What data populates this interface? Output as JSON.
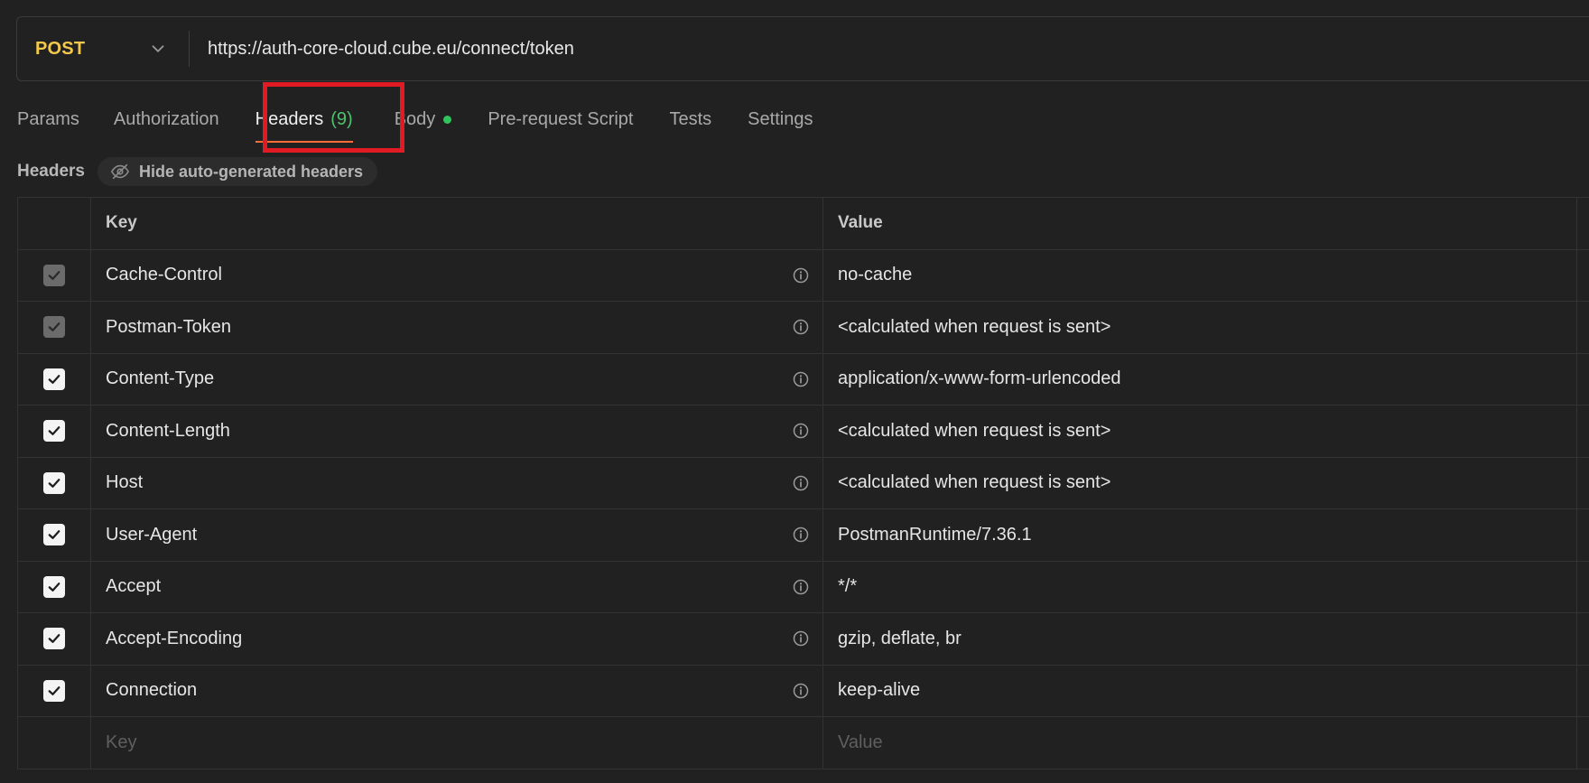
{
  "request": {
    "method": "POST",
    "url": "https://auth-core-cloud.cube.eu/connect/token"
  },
  "tabs": [
    {
      "label": "Params"
    },
    {
      "label": "Authorization"
    },
    {
      "label": "Headers",
      "count": "(9)"
    },
    {
      "label": "Body"
    },
    {
      "label": "Pre-request Script"
    },
    {
      "label": "Tests"
    },
    {
      "label": "Settings"
    }
  ],
  "headers_section": {
    "title": "Headers",
    "hide_button": "Hide auto-generated headers"
  },
  "table": {
    "columns": {
      "key": "Key",
      "value": "Value"
    },
    "rows": [
      {
        "key": "Cache-Control",
        "value": "no-cache",
        "checked": true,
        "disabled": true
      },
      {
        "key": "Postman-Token",
        "value": "<calculated when request is sent>",
        "checked": true,
        "disabled": true
      },
      {
        "key": "Content-Type",
        "value": "application/x-www-form-urlencoded",
        "checked": true,
        "disabled": false
      },
      {
        "key": "Content-Length",
        "value": "<calculated when request is sent>",
        "checked": true,
        "disabled": false
      },
      {
        "key": "Host",
        "value": "<calculated when request is sent>",
        "checked": true,
        "disabled": false
      },
      {
        "key": "User-Agent",
        "value": "PostmanRuntime/7.36.1",
        "checked": true,
        "disabled": false
      },
      {
        "key": "Accept",
        "value": "*/*",
        "checked": true,
        "disabled": false
      },
      {
        "key": "Accept-Encoding",
        "value": "gzip, deflate, br",
        "checked": true,
        "disabled": false
      },
      {
        "key": "Connection",
        "value": "keep-alive",
        "checked": true,
        "disabled": false
      }
    ],
    "placeholder": {
      "key": "Key",
      "value": "Value"
    }
  },
  "colors": {
    "method": "#f2c94c",
    "count": "#4ec26a",
    "body_dot": "#2fc55a",
    "active_underline": "#ff6c37",
    "highlight": "#e01b24"
  }
}
